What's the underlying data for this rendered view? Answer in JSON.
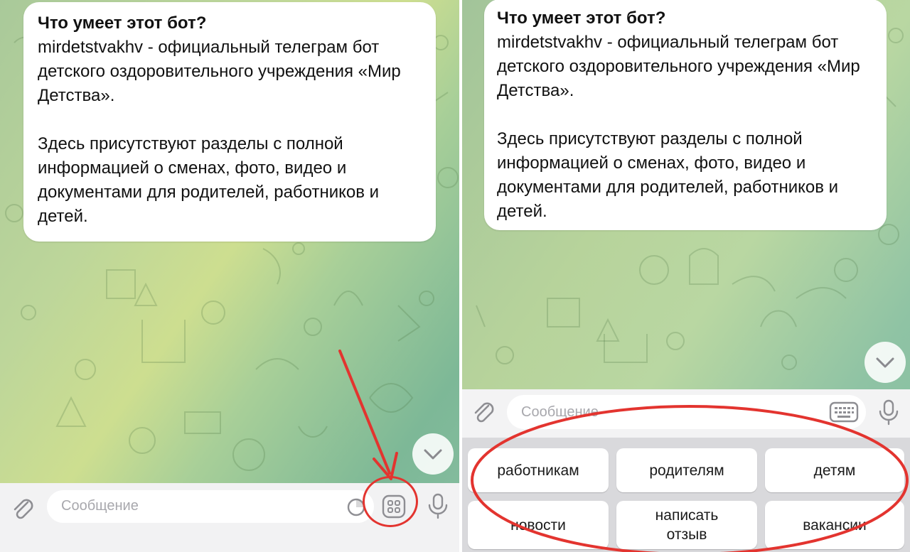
{
  "left_panel": {
    "bubble": {
      "title": "Что умеет этот бот?",
      "body": "mirdetstvakhv - официальный телеграм бот детского оздоровительного учреждения «Мир Детства».\n\nЗдесь присутствуют разделы с полной информацией о сменах, фото, видео и документами для родителей, работников и детей."
    },
    "input": {
      "placeholder": "Сообщение"
    },
    "icons": [
      "attach-icon",
      "sticker-icon",
      "bot-menu-icon",
      "microphone-icon",
      "chevron-down-icon"
    ],
    "annotation_color": "#e3342f"
  },
  "right_panel": {
    "bubble": {
      "title": "Что умеет этот бот?",
      "body": "mirdetstvakhv - официальный телеграм бот детского оздоровительного учреждения «Мир Детства».\n\nЗдесь присутствуют разделы с полной информацией о сменах, фото, видео и документами для родителей, работников и детей."
    },
    "input": {
      "placeholder": "Сообщение"
    },
    "keyboard": {
      "row1": [
        "работникам",
        "родителям",
        "детям"
      ],
      "row2": [
        "новости",
        "написать\nотзыв",
        "вакансии"
      ]
    },
    "icons": [
      "attach-icon",
      "keyboard-icon",
      "microphone-icon",
      "chevron-down-icon"
    ],
    "annotation_color": "#e3342f"
  }
}
